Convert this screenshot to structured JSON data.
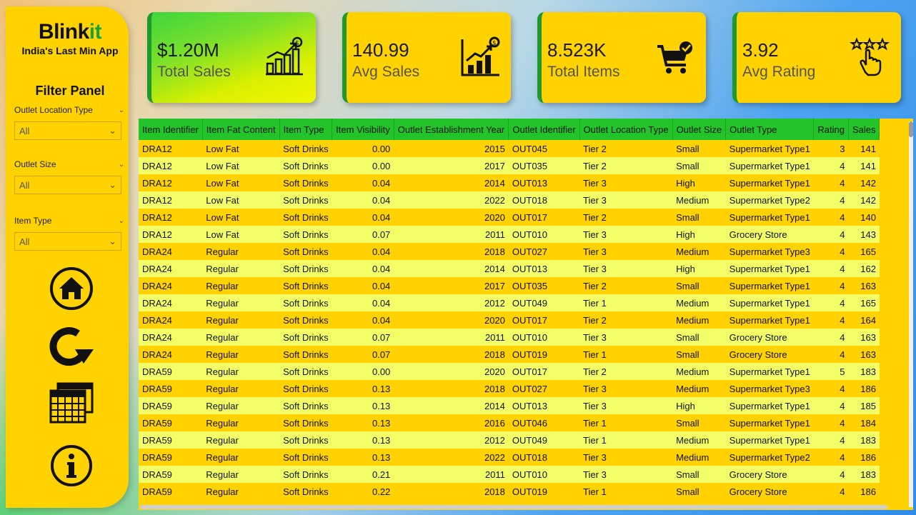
{
  "brand": {
    "name_main": "Blink",
    "name_accent": "it",
    "tagline": "India's Last Min App"
  },
  "filters": {
    "title": "Filter Panel",
    "items": [
      {
        "label": "Outlet Location Type",
        "value": "All"
      },
      {
        "label": "Outlet Size",
        "value": "All"
      },
      {
        "label": "Item Type",
        "value": "All"
      }
    ]
  },
  "nav_icons": [
    "home-icon",
    "refresh-icon",
    "calendar-icon",
    "info-icon"
  ],
  "kpis": [
    {
      "value": "$1.20M",
      "label": "Total Sales",
      "icon": "sales-chart-icon"
    },
    {
      "value": "140.99",
      "label": "Avg Sales",
      "icon": "bar-chart-dollar-icon"
    },
    {
      "value": "8.523K",
      "label": "Total Items",
      "icon": "shopping-cart-icon"
    },
    {
      "value": "3.92",
      "label": "Avg Rating",
      "icon": "stars-rating-icon"
    }
  ],
  "colors": {
    "brand_yellow": "#ffd200",
    "header_green": "#22c42a",
    "row_light": "#f4ff68",
    "accent_green": "#1aa33a"
  },
  "table": {
    "columns": [
      "Item Identifier",
      "Item Fat Content",
      "Item Type",
      "Item Visibility",
      "Outlet Establishment Year",
      "Outlet Identifier",
      "Outlet Location Type",
      "Outlet Size",
      "Outlet Type",
      "Rating",
      "Sales"
    ],
    "rows": [
      [
        "DRA12",
        "Low Fat",
        "Soft Drinks",
        "0.00",
        "2015",
        "OUT045",
        "Tier 2",
        "Small",
        "Supermarket Type1",
        "3",
        "141"
      ],
      [
        "DRA12",
        "Low Fat",
        "Soft Drinks",
        "0.00",
        "2017",
        "OUT035",
        "Tier 2",
        "Small",
        "Supermarket Type1",
        "4",
        "141"
      ],
      [
        "DRA12",
        "Low Fat",
        "Soft Drinks",
        "0.04",
        "2014",
        "OUT013",
        "Tier 3",
        "High",
        "Supermarket Type1",
        "4",
        "142"
      ],
      [
        "DRA12",
        "Low Fat",
        "Soft Drinks",
        "0.04",
        "2022",
        "OUT018",
        "Tier 3",
        "Medium",
        "Supermarket Type2",
        "4",
        "142"
      ],
      [
        "DRA12",
        "Low Fat",
        "Soft Drinks",
        "0.04",
        "2020",
        "OUT017",
        "Tier 2",
        "Small",
        "Supermarket Type1",
        "4",
        "140"
      ],
      [
        "DRA12",
        "Low Fat",
        "Soft Drinks",
        "0.07",
        "2011",
        "OUT010",
        "Tier 3",
        "High",
        "Grocery Store",
        "4",
        "143"
      ],
      [
        "DRA24",
        "Regular",
        "Soft Drinks",
        "0.04",
        "2018",
        "OUT027",
        "Tier 3",
        "Medium",
        "Supermarket Type3",
        "4",
        "165"
      ],
      [
        "DRA24",
        "Regular",
        "Soft Drinks",
        "0.04",
        "2014",
        "OUT013",
        "Tier 3",
        "High",
        "Supermarket Type1",
        "4",
        "162"
      ],
      [
        "DRA24",
        "Regular",
        "Soft Drinks",
        "0.04",
        "2017",
        "OUT035",
        "Tier 2",
        "Small",
        "Supermarket Type1",
        "4",
        "163"
      ],
      [
        "DRA24",
        "Regular",
        "Soft Drinks",
        "0.04",
        "2012",
        "OUT049",
        "Tier 1",
        "Medium",
        "Supermarket Type1",
        "4",
        "165"
      ],
      [
        "DRA24",
        "Regular",
        "Soft Drinks",
        "0.04",
        "2020",
        "OUT017",
        "Tier 2",
        "Medium",
        "Supermarket Type1",
        "4",
        "164"
      ],
      [
        "DRA24",
        "Regular",
        "Soft Drinks",
        "0.07",
        "2011",
        "OUT010",
        "Tier 3",
        "Small",
        "Grocery Store",
        "4",
        "163"
      ],
      [
        "DRA24",
        "Regular",
        "Soft Drinks",
        "0.07",
        "2018",
        "OUT019",
        "Tier 1",
        "Small",
        "Grocery Store",
        "4",
        "163"
      ],
      [
        "DRA59",
        "Regular",
        "Soft Drinks",
        "0.00",
        "2020",
        "OUT017",
        "Tier 2",
        "Medium",
        "Supermarket Type1",
        "5",
        "183"
      ],
      [
        "DRA59",
        "Regular",
        "Soft Drinks",
        "0.13",
        "2018",
        "OUT027",
        "Tier 3",
        "Medium",
        "Supermarket Type3",
        "4",
        "186"
      ],
      [
        "DRA59",
        "Regular",
        "Soft Drinks",
        "0.13",
        "2014",
        "OUT013",
        "Tier 3",
        "High",
        "Supermarket Type1",
        "4",
        "185"
      ],
      [
        "DRA59",
        "Regular",
        "Soft Drinks",
        "0.13",
        "2016",
        "OUT046",
        "Tier 1",
        "Small",
        "Supermarket Type1",
        "4",
        "184"
      ],
      [
        "DRA59",
        "Regular",
        "Soft Drinks",
        "0.13",
        "2012",
        "OUT049",
        "Tier 1",
        "Medium",
        "Supermarket Type1",
        "4",
        "183"
      ],
      [
        "DRA59",
        "Regular",
        "Soft Drinks",
        "0.13",
        "2022",
        "OUT018",
        "Tier 3",
        "Medium",
        "Supermarket Type2",
        "4",
        "186"
      ],
      [
        "DRA59",
        "Regular",
        "Soft Drinks",
        "0.21",
        "2011",
        "OUT010",
        "Tier 3",
        "Small",
        "Grocery Store",
        "4",
        "183"
      ],
      [
        "DRA59",
        "Regular",
        "Soft Drinks",
        "0.22",
        "2018",
        "OUT019",
        "Tier 1",
        "Small",
        "Grocery Store",
        "4",
        "186"
      ]
    ]
  }
}
